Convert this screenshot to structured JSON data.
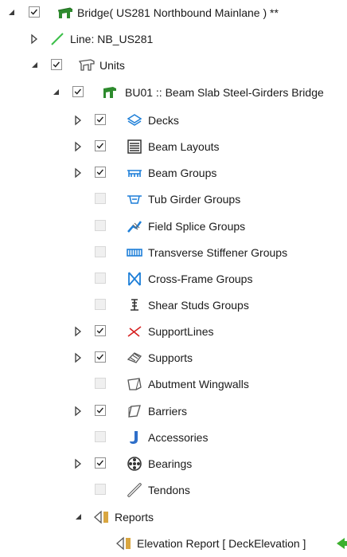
{
  "tree": {
    "root": {
      "label": "Bridge( US281 Northbound Mainlane ) **",
      "checked": true,
      "expanded": true
    },
    "line": {
      "label": "Line: NB_US281",
      "expanded": false
    },
    "units": {
      "label": "Units",
      "checked": true,
      "expanded": true
    },
    "unit": {
      "label": "BU01 :: Beam Slab Steel-Girders Bridge",
      "checked": true,
      "expanded": true
    },
    "items": [
      {
        "label": "Decks",
        "checked": true,
        "expandable": true,
        "icon": "decks-icon",
        "color": "#1e7fd8"
      },
      {
        "label": "Beam Layouts",
        "checked": true,
        "expandable": true,
        "icon": "beam-layouts-icon",
        "color": "#333333"
      },
      {
        "label": "Beam Groups",
        "checked": true,
        "expandable": true,
        "icon": "beam-groups-icon",
        "color": "#1e7fd8"
      },
      {
        "label": "Tub Girder Groups",
        "checked": false,
        "expandable": false,
        "icon": "tub-girder-icon",
        "color": "#1e7fd8"
      },
      {
        "label": "Field Splice Groups",
        "checked": false,
        "expandable": false,
        "icon": "field-splice-icon",
        "color": "#1e7fd8"
      },
      {
        "label": "Transverse Stiffener Groups",
        "checked": false,
        "expandable": false,
        "icon": "stiffener-icon",
        "color": "#1e7fd8"
      },
      {
        "label": "Cross-Frame Groups",
        "checked": false,
        "expandable": false,
        "icon": "cross-frame-icon",
        "color": "#1e7fd8"
      },
      {
        "label": "Shear Studs Groups",
        "checked": false,
        "expandable": false,
        "icon": "shear-studs-icon",
        "color": "#333333"
      },
      {
        "label": "SupportLines",
        "checked": true,
        "expandable": true,
        "icon": "support-lines-icon",
        "color": "#d62020"
      },
      {
        "label": "Supports",
        "checked": true,
        "expandable": true,
        "icon": "supports-icon",
        "color": "#555555"
      },
      {
        "label": "Abutment Wingwalls",
        "checked": false,
        "expandable": false,
        "icon": "wingwall-icon",
        "color": "#555555"
      },
      {
        "label": "Barriers",
        "checked": true,
        "expandable": true,
        "icon": "barrier-icon",
        "color": "#555555"
      },
      {
        "label": "Accessories",
        "checked": false,
        "expandable": false,
        "icon": "accessories-icon",
        "color": "#2f6fc9"
      },
      {
        "label": "Bearings",
        "checked": true,
        "expandable": true,
        "icon": "bearings-icon",
        "color": "#333333"
      },
      {
        "label": "Tendons",
        "checked": false,
        "expandable": false,
        "icon": "tendons-icon",
        "color": "#555555"
      }
    ],
    "reports": {
      "label": "Reports",
      "expanded": true
    },
    "report_item": {
      "label": "Elevation Report [ DeckElevation ]"
    }
  }
}
